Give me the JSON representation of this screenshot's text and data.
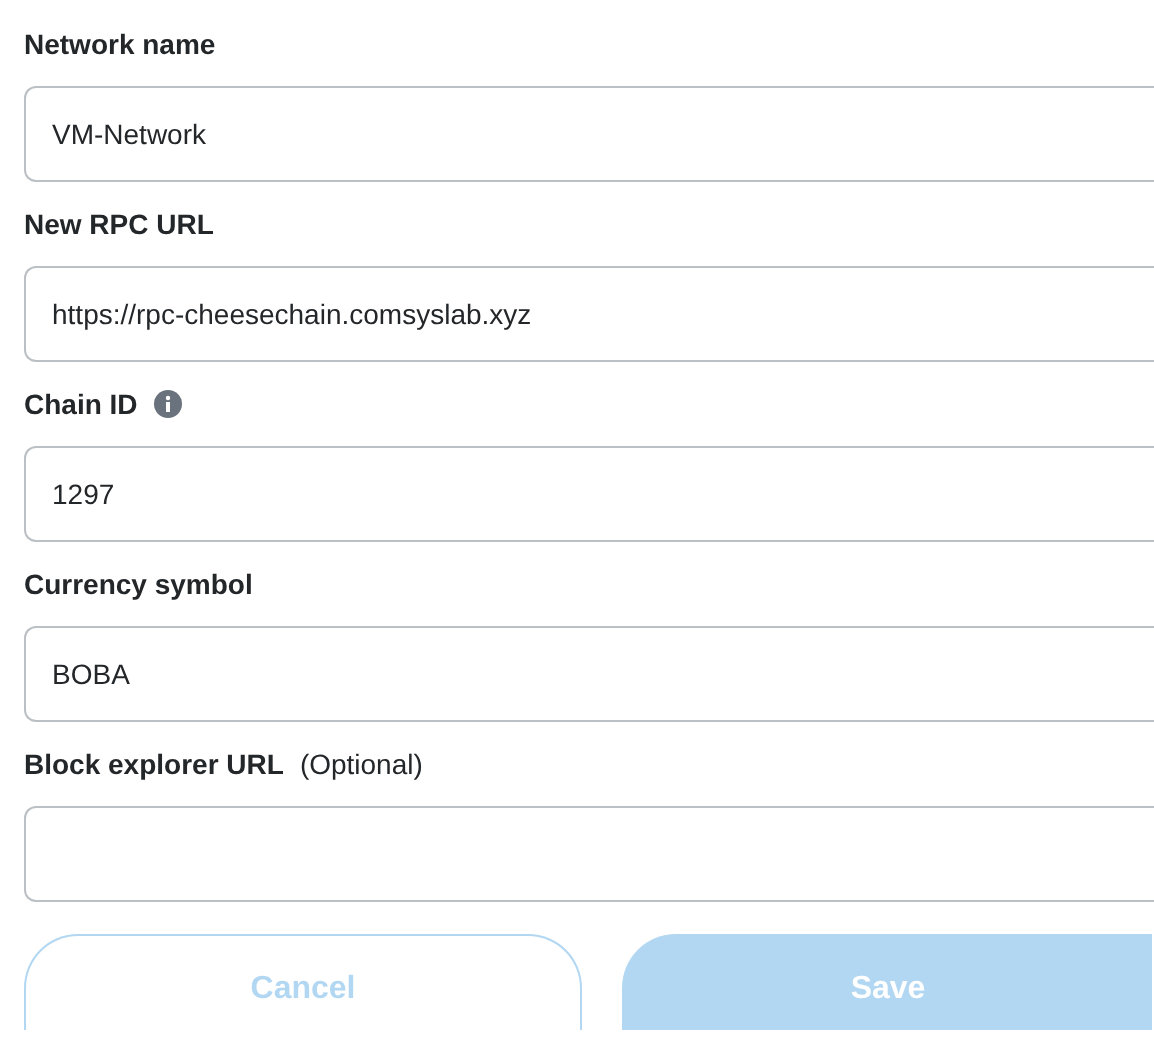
{
  "fields": [
    {
      "label": "Network name",
      "value": "VM-Network"
    },
    {
      "label": "New RPC URL",
      "value": "https://rpc-cheesechain.comsyslab.xyz"
    },
    {
      "label": "Chain ID",
      "info_icon": true,
      "value": "1297"
    },
    {
      "label": "Currency symbol",
      "value": "BOBA"
    },
    {
      "label": "Block explorer URL",
      "note": "(Optional)"
    }
  ],
  "buttons": [
    {
      "label": "Cancel",
      "kind": "secondary",
      "disabled": true
    },
    {
      "label": "Save",
      "kind": "primary",
      "disabled": true
    }
  ]
}
